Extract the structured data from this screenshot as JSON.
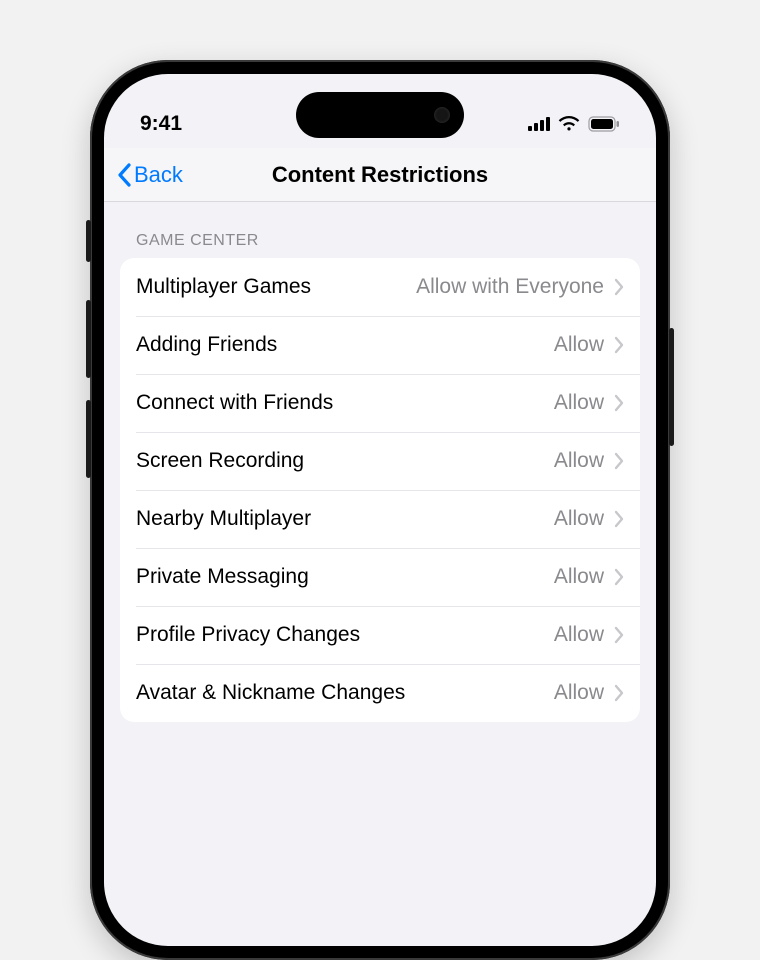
{
  "statusBar": {
    "time": "9:41"
  },
  "nav": {
    "back": "Back",
    "title": "Content Restrictions"
  },
  "section": {
    "header": "GAME CENTER"
  },
  "rows": [
    {
      "label": "Multiplayer Games",
      "value": "Allow with Everyone"
    },
    {
      "label": "Adding Friends",
      "value": "Allow"
    },
    {
      "label": "Connect with Friends",
      "value": "Allow"
    },
    {
      "label": "Screen Recording",
      "value": "Allow"
    },
    {
      "label": "Nearby Multiplayer",
      "value": "Allow"
    },
    {
      "label": "Private Messaging",
      "value": "Allow"
    },
    {
      "label": "Profile Privacy Changes",
      "value": "Allow"
    },
    {
      "label": "Avatar & Nickname Changes",
      "value": "Allow"
    }
  ]
}
